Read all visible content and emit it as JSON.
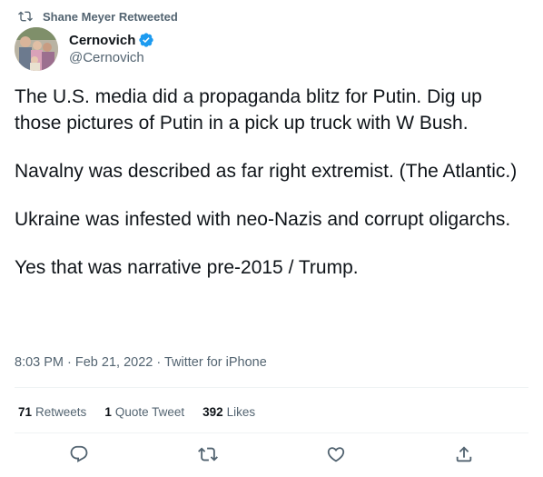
{
  "retweeter": {
    "text": "Shane Meyer Retweeted",
    "icon": "retweet-icon"
  },
  "author": {
    "name": "Cernovich",
    "handle": "@Cernovich",
    "verified": true,
    "verified_icon": "verified-badge-icon"
  },
  "tweet": {
    "paragraphs": [
      "The U.S. media did a propaganda blitz for Putin. Dig up those pictures of Putin in a pick up truck with W Bush.",
      "Navalny was described as far right extremist. (The Atlantic.)",
      "Ukraine was infested with neo-Nazis and corrupt oligarchs.",
      "Yes that was narrative pre-2015 / Trump."
    ],
    "timestamp": "8:03 PM · Feb 21, 2022 · Twitter for iPhone"
  },
  "stats": [
    {
      "count": "71",
      "label": "Retweets"
    },
    {
      "count": "1",
      "label": "Quote Tweet"
    },
    {
      "count": "392",
      "label": "Likes"
    }
  ],
  "actions": [
    "reply-icon",
    "retweet-icon",
    "like-icon",
    "share-icon"
  ],
  "colors": {
    "text_primary": "#0f1419",
    "text_secondary": "#536471",
    "verified_blue": "#1d9bf0",
    "divider": "#eff3f4"
  }
}
